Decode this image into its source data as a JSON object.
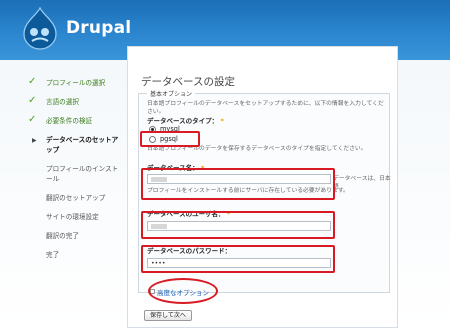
{
  "header": {
    "brand": "Drupal"
  },
  "sidebar": {
    "steps": [
      {
        "label": "プロフィールの選択",
        "state": "done"
      },
      {
        "label": "言語の選択",
        "state": "done"
      },
      {
        "label": "必要条件の検証",
        "state": "done"
      },
      {
        "label": "データベースのセットアップ",
        "state": "active"
      },
      {
        "label": "プロフィールのインストール",
        "state": "pending"
      },
      {
        "label": "翻訳のセットアップ",
        "state": "pending"
      },
      {
        "label": "サイトの環境設定",
        "state": "pending"
      },
      {
        "label": "翻訳の完了",
        "state": "pending"
      },
      {
        "label": "完了",
        "state": "pending"
      }
    ]
  },
  "main": {
    "title": "データベースの設定",
    "fieldset_legend": "基本オプション",
    "intro": "日本語プロフィールのデータベースをセットアップするために、以下の情報を入力してください。",
    "db_type_label": "データベースのタイプ：",
    "db_type_options": [
      "mysql",
      "pgsql"
    ],
    "db_type_selected": "mysql",
    "db_type_desc": "日本語プロフィールのデータを保存するデータベースのタイプを指定してください。",
    "db_name_label": "データベース名：",
    "db_name_desc_right": "データベースは、日本語",
    "db_name_desc": "プロフィールをインストールする前にサーバに存在している必要があります。",
    "db_user_label": "データベースのユーザ名：",
    "db_pass_label": "データベースのパスワード：",
    "db_pass_value": "••••",
    "required_mark": "*",
    "advanced_label": "高度なオプション",
    "submit_label": "保存して次へ"
  },
  "colors": {
    "accent": "#2b86cf",
    "annotation": "#d81b23",
    "done": "#4aa024"
  }
}
